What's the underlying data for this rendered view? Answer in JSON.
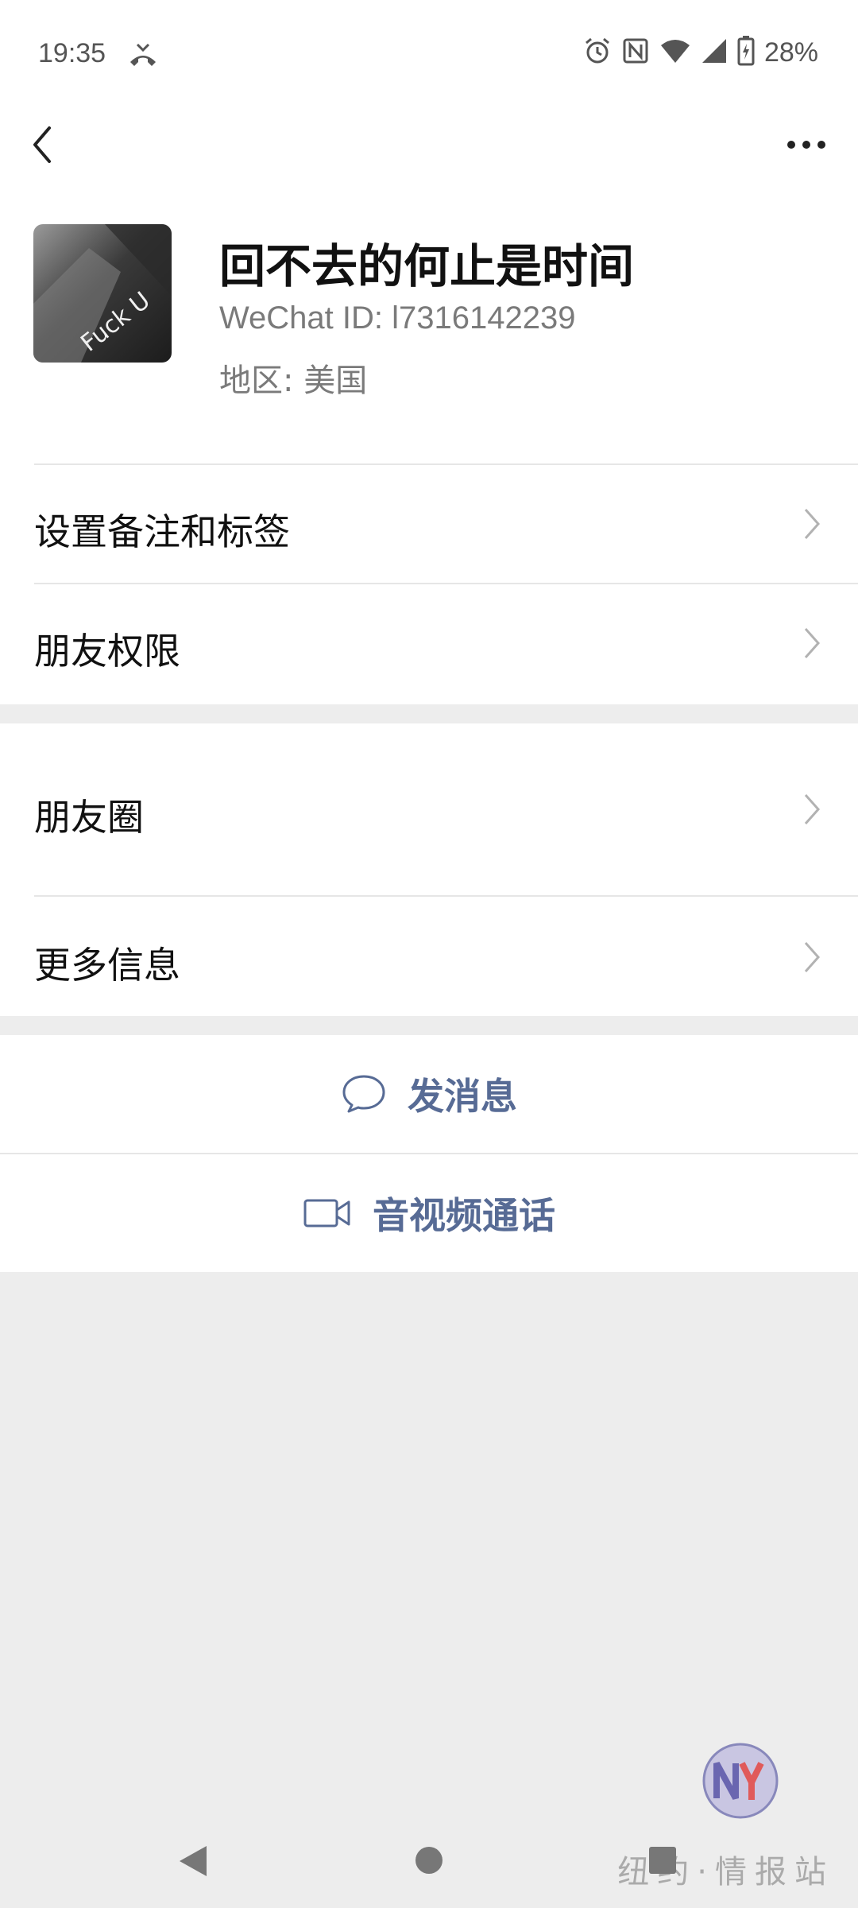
{
  "status_bar": {
    "time": "19:35",
    "battery": "28%",
    "icons": [
      "missed-call-icon",
      "alarm-icon",
      "nfc-icon",
      "wifi-icon",
      "signal-icon",
      "battery-charging-icon"
    ]
  },
  "topbar": {
    "back_icon": "back-chevron-icon",
    "more_icon": "more-dots-icon"
  },
  "profile": {
    "avatar_text": "Fuck U",
    "name": "回不去的何止是时间",
    "wechat_id": "WeChat ID:  l7316142239",
    "region": "地区:  美国"
  },
  "menu": {
    "remark_tags": "设置备注和标签",
    "friend_permissions": "朋友权限",
    "moments": "朋友圈",
    "more_info": "更多信息"
  },
  "actions": {
    "send_message": "发消息",
    "video_call": "音视频通话"
  },
  "colors": {
    "link": "#576b95",
    "background": "#ededed"
  },
  "watermark": {
    "text": "纽约·情报站"
  }
}
